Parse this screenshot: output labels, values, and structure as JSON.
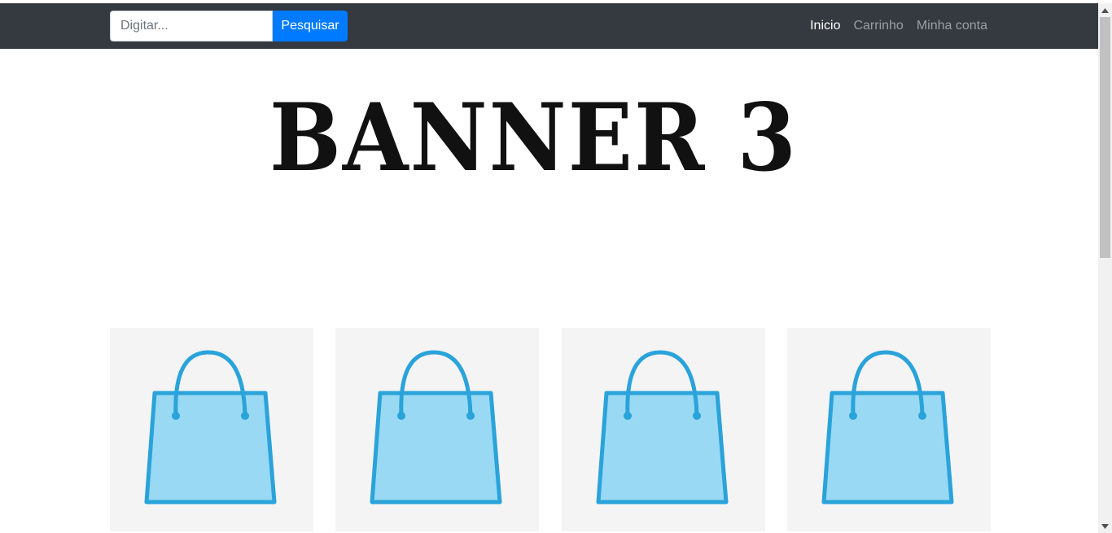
{
  "navbar": {
    "search": {
      "placeholder": "Digitar...",
      "value": ""
    },
    "search_button_label": "Pesquisar",
    "links": [
      {
        "label": "Inicio",
        "active": true
      },
      {
        "label": "Carrinho",
        "active": false
      },
      {
        "label": "Minha conta",
        "active": false
      }
    ]
  },
  "banner": {
    "text": "BANNER 3"
  },
  "products": [
    {
      "image": "shopping-bag-icon"
    },
    {
      "image": "shopping-bag-icon"
    },
    {
      "image": "shopping-bag-icon"
    },
    {
      "image": "shopping-bag-icon"
    }
  ],
  "colors": {
    "navbar_bg": "#343a40",
    "button_primary": "#007bff",
    "bag_fill": "#99d9f4",
    "bag_stroke": "#2aa3da",
    "card_bg": "#f4f4f4"
  }
}
